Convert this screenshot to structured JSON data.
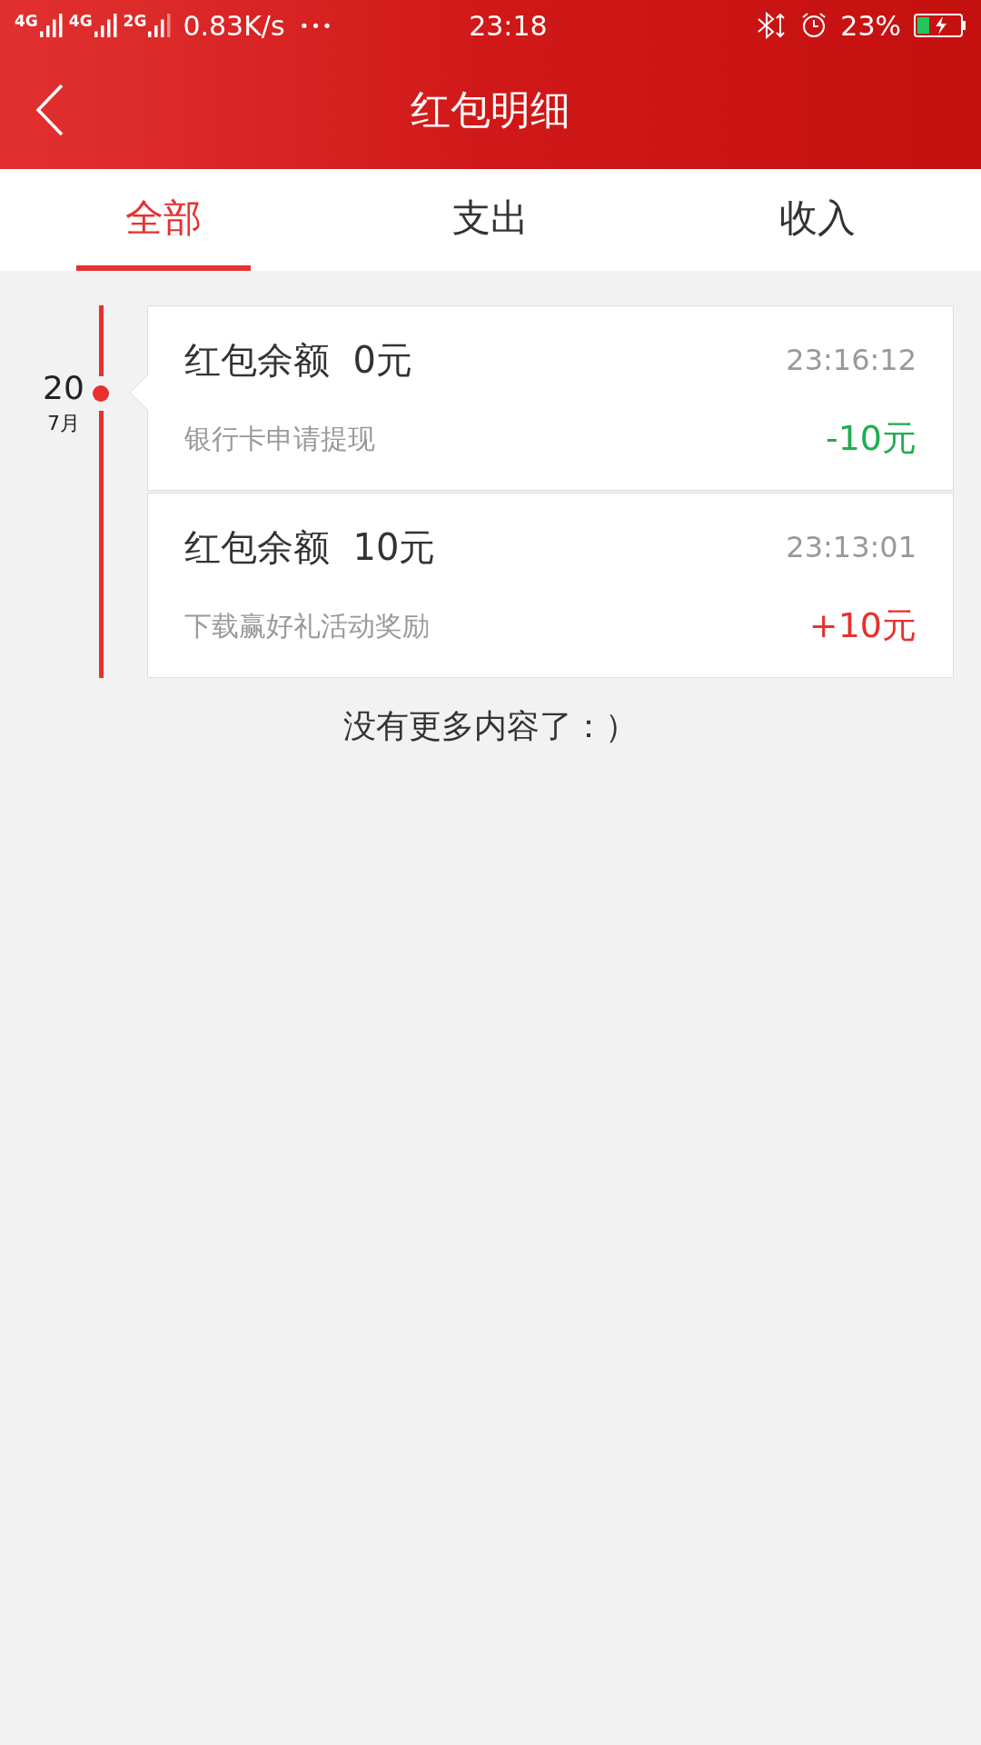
{
  "status_bar": {
    "networks": [
      "4G",
      "4G",
      "2G"
    ],
    "speed": "0.83K/s",
    "dots": "•••",
    "time": "23:18",
    "battery": "23%"
  },
  "header": {
    "title": "红包明细"
  },
  "tabs": [
    {
      "label": "全部",
      "selected": true
    },
    {
      "label": "支出",
      "selected": false
    },
    {
      "label": "收入",
      "selected": false
    }
  ],
  "date": {
    "day": "20",
    "month": "7月"
  },
  "records": [
    {
      "title": "红包余额  0元",
      "time": "23:16:12",
      "description": "银行卡申请提现",
      "amount": "-10元",
      "kind": "expense"
    },
    {
      "title": "红包余额  10元",
      "time": "23:13:01",
      "description": "下载赢好礼活动奖励",
      "amount": "+10元",
      "kind": "income"
    }
  ],
  "end_note": "没有更多内容了：）"
}
